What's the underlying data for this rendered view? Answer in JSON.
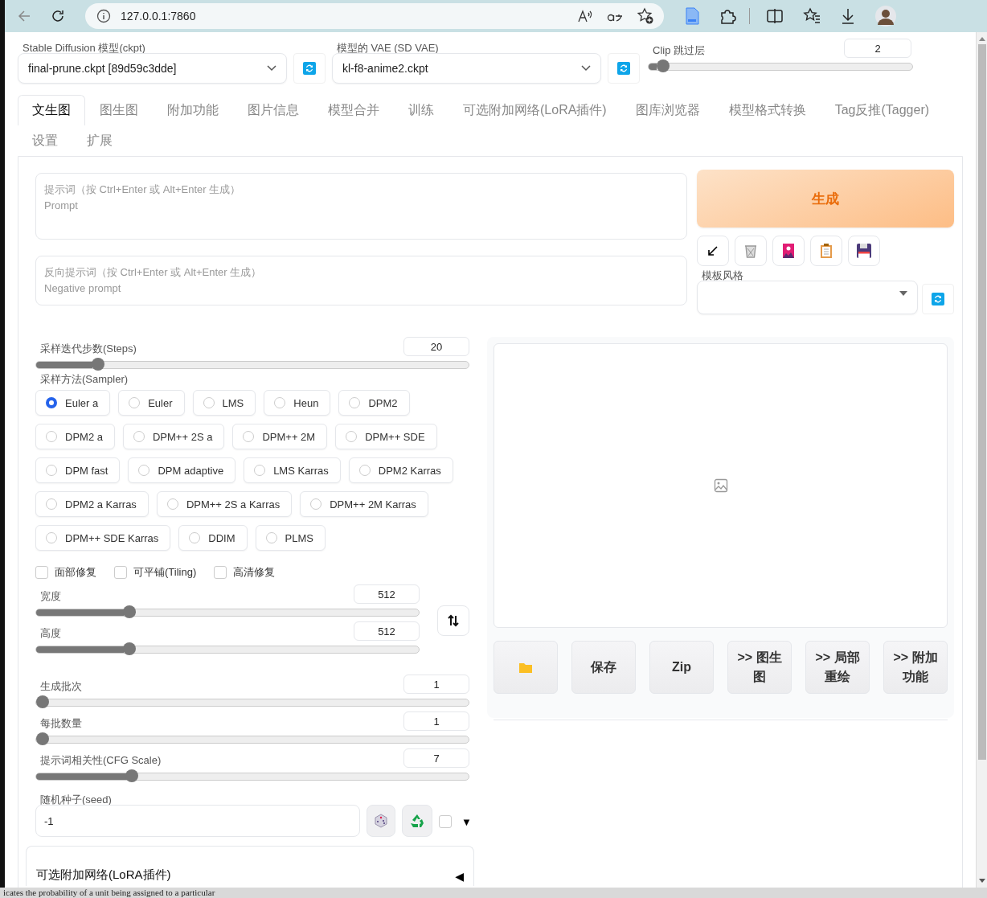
{
  "browser": {
    "url": "127.0.0.1:7860"
  },
  "top_settings": {
    "model": {
      "label": "Stable Diffusion 模型(ckpt)",
      "value": "final-prune.ckpt [89d59c3dde]"
    },
    "vae": {
      "label": "模型的 VAE (SD VAE)",
      "value": "kl-f8-anime2.ckpt"
    },
    "clip_skip": {
      "label": "Clip 跳过层",
      "value": "2",
      "level": 0.03
    }
  },
  "tabs": [
    {
      "label": "文生图",
      "selected": true
    },
    {
      "label": "图生图",
      "selected": false
    },
    {
      "label": "附加功能",
      "selected": false
    },
    {
      "label": "图片信息",
      "selected": false
    },
    {
      "label": "模型合并",
      "selected": false
    },
    {
      "label": "训练",
      "selected": false
    },
    {
      "label": "可选附加网络(LoRA插件)",
      "selected": false
    },
    {
      "label": "图库浏览器",
      "selected": false
    },
    {
      "label": "模型格式转换",
      "selected": false
    },
    {
      "label": "Tag反推(Tagger)",
      "selected": false
    },
    {
      "label": "设置",
      "selected": false
    },
    {
      "label": "扩展",
      "selected": false
    }
  ],
  "prompt": {
    "placeholder": "提示词（按 Ctrl+Enter 或 Alt+Enter 生成）\nPrompt"
  },
  "negative_prompt": {
    "placeholder": "反向提示词（按 Ctrl+Enter 或 Alt+Enter 生成）\nNegative prompt"
  },
  "generate_button": "生成",
  "tool_buttons": [
    {
      "kind": "arrow"
    },
    {
      "kind": "trash"
    },
    {
      "kind": "picture-card"
    },
    {
      "kind": "clipboard"
    },
    {
      "kind": "floppy"
    }
  ],
  "style_dropdown": {
    "label": "模板风格"
  },
  "steps": {
    "label": "采样迭代步数(Steps)",
    "value": "20",
    "level": 0.13
  },
  "sampler": {
    "label": "采样方法(Sampler)",
    "options": [
      {
        "label": "Euler a",
        "selected": true
      },
      {
        "label": "Euler",
        "selected": false
      },
      {
        "label": "LMS",
        "selected": false
      },
      {
        "label": "Heun",
        "selected": false
      },
      {
        "label": "DPM2",
        "selected": false
      },
      {
        "label": "DPM2 a",
        "selected": false
      },
      {
        "label": "DPM++ 2S a",
        "selected": false
      },
      {
        "label": "DPM++ 2M",
        "selected": false
      },
      {
        "label": "DPM++ SDE",
        "selected": false
      },
      {
        "label": "DPM fast",
        "selected": false
      },
      {
        "label": "DPM adaptive",
        "selected": false
      },
      {
        "label": "LMS Karras",
        "selected": false
      },
      {
        "label": "DPM2 Karras",
        "selected": false
      },
      {
        "label": "DPM2 a Karras",
        "selected": false
      },
      {
        "label": "DPM++ 2S a Karras",
        "selected": false
      },
      {
        "label": "DPM++ 2M Karras",
        "selected": false
      },
      {
        "label": "DPM++ SDE Karras",
        "selected": false
      },
      {
        "label": "DDIM",
        "selected": false
      },
      {
        "label": "PLMS",
        "selected": false
      }
    ]
  },
  "checkboxes": [
    {
      "label": "面部修复",
      "checked": false
    },
    {
      "label": "可平铺(Tiling)",
      "checked": false
    },
    {
      "label": "高清修复",
      "checked": false
    }
  ],
  "size_sliders": [
    {
      "label": "宽度",
      "value": "512",
      "level": 0.23
    },
    {
      "label": "高度",
      "value": "512",
      "level": 0.23
    }
  ],
  "batch_sliders": [
    {
      "label": "生成批次",
      "value": "1",
      "level": 0
    },
    {
      "label": "每批数量",
      "value": "1",
      "level": 0
    },
    {
      "label": "提示词相关性(CFG Scale)",
      "value": "7",
      "level": 0.21
    }
  ],
  "seed": {
    "label": "随机种子(seed)",
    "value": "-1",
    "extra_checked": false,
    "toggle": "▼"
  },
  "accordion": {
    "label": "可选附加网络(LoRA插件)",
    "expanded": false,
    "arrow": "◀"
  },
  "gallery": {
    "buttons": [
      {
        "kind": "folder"
      },
      {
        "kind": "text",
        "label": "保存"
      },
      {
        "kind": "text",
        "label": "Zip"
      },
      {
        "kind": "text",
        "label": ">> 图生图"
      },
      {
        "kind": "text",
        "label": ">> 局部重绘"
      },
      {
        "kind": "text",
        "label": ">> 附加功能"
      }
    ]
  },
  "background_text": "icates the probability of a unit being assigned to a particular"
}
